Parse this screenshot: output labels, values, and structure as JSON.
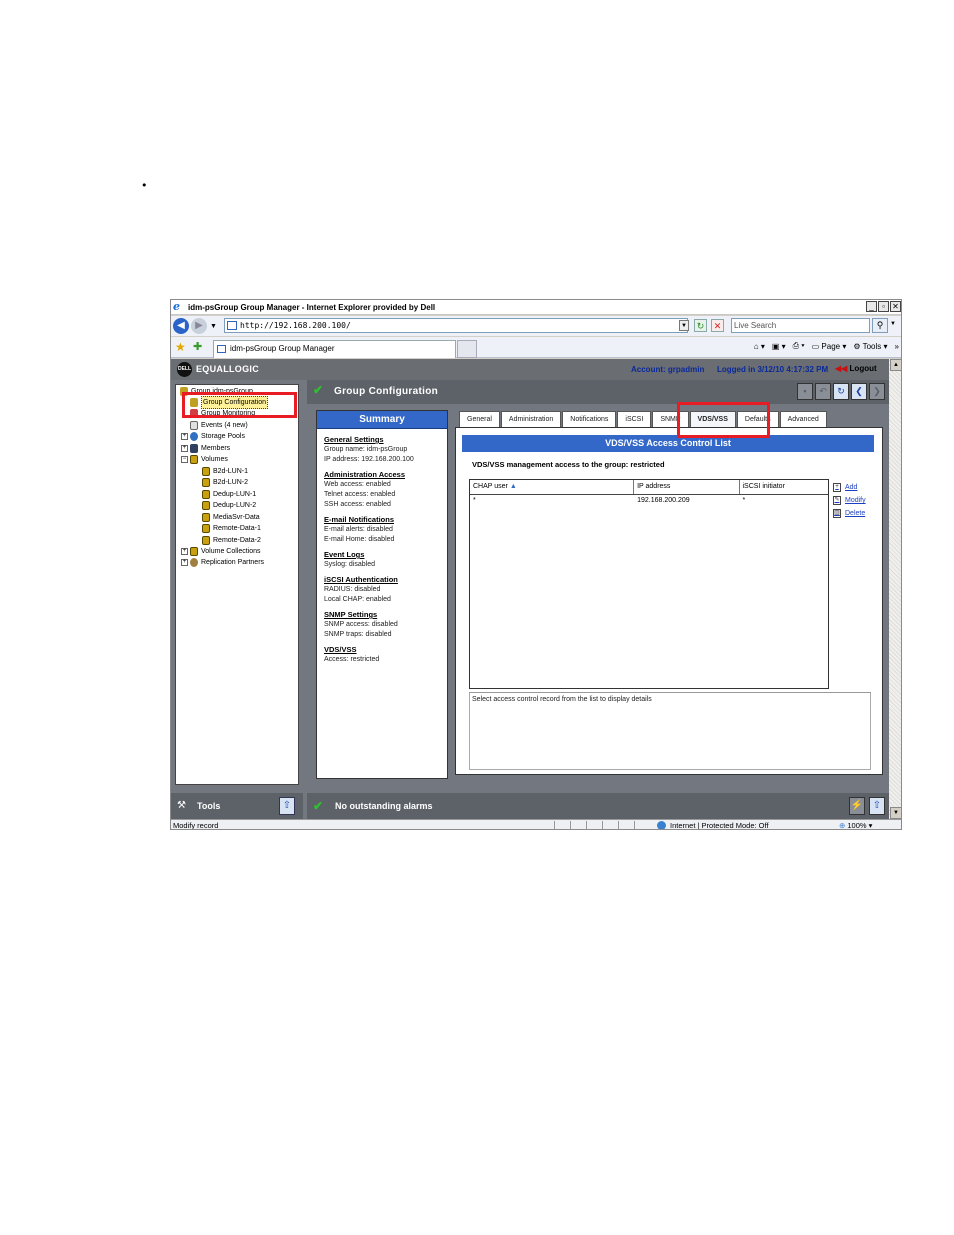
{
  "bullet": "•",
  "browser": {
    "title": "idm-psGroup Group Manager - Internet Explorer provided by Dell",
    "url": "http://192.168.200.100/",
    "search_placeholder": "Live Search",
    "tab_label": "idm-psGroup Group Manager",
    "cmd_page": "Page",
    "cmd_tools": "Tools",
    "window_buttons": [
      "_",
      "▫",
      "✕"
    ],
    "more": "»"
  },
  "app": {
    "brand": "EQUALLOGIC",
    "account": "Account: grpadmin",
    "logged_in": "Logged in 3/12/10 4:17:32 PM",
    "logout": "Logout"
  },
  "tree": {
    "items": [
      {
        "label": "Group idm-psGroup",
        "icon": "group-icon"
      },
      {
        "label": "Group Configuration",
        "icon": "group-config-icon"
      },
      {
        "label": "Group Monitoring",
        "icon": "monitoring-icon"
      },
      {
        "label": "Events (4 new)",
        "icon": "events-icon"
      },
      {
        "label": "Storage Pools",
        "icon": "storage-pool-icon"
      },
      {
        "label": "Members",
        "icon": "members-icon"
      },
      {
        "label": "Volumes",
        "icon": "volumes-icon"
      },
      {
        "label": "B2d-LUN-1",
        "icon": "volume-icon"
      },
      {
        "label": "B2d-LUN-2",
        "icon": "volume-icon"
      },
      {
        "label": "Dedup-LUN-1",
        "icon": "volume-icon"
      },
      {
        "label": "Dedup-LUN-2",
        "icon": "volume-icon"
      },
      {
        "label": "MediaSvr-Data",
        "icon": "volume-icon"
      },
      {
        "label": "Remote-Data-1",
        "icon": "volume-icon"
      },
      {
        "label": "Remote-Data-2",
        "icon": "volume-icon"
      },
      {
        "label": "Volume Collections",
        "icon": "collections-icon"
      },
      {
        "label": "Replication Partners",
        "icon": "replication-icon"
      }
    ]
  },
  "tools_label": "Tools",
  "config_header": "Group Configuration",
  "summary": {
    "title": "Summary",
    "sections": [
      {
        "heading": "General Settings",
        "lines": [
          "Group name: idm-psGroup",
          "IP address: 192.168.200.100"
        ]
      },
      {
        "heading": "Administration Access",
        "lines": [
          "Web access: enabled",
          "Telnet access: enabled",
          "SSH access: enabled"
        ]
      },
      {
        "heading": "E-mail Notifications",
        "lines": [
          "E-mail alerts: disabled",
          "E-mail Home: disabled"
        ]
      },
      {
        "heading": "Event Logs",
        "lines": [
          "Syslog: disabled"
        ]
      },
      {
        "heading": "iSCSI Authentication",
        "lines": [
          "RADIUS: disabled",
          "Local CHAP: enabled"
        ]
      },
      {
        "heading": "SNMP Settings",
        "lines": [
          "SNMP access: disabled",
          "SNMP traps: disabled"
        ]
      },
      {
        "heading": "VDS/VSS",
        "lines": [
          "Access: restricted"
        ]
      }
    ]
  },
  "tabs": [
    "General",
    "Administration",
    "Notifications",
    "iSCSI",
    "SNMP",
    "VDS/VSS",
    "Defaults",
    "Advanced"
  ],
  "vds": {
    "title": "VDS/VSS Access Control List",
    "message": "VDS/VSS management access to the group: restricted",
    "columns": [
      "CHAP user",
      "IP address",
      "iSCSI initiator"
    ],
    "rows": [
      [
        "*",
        "192.168.200.209",
        "*"
      ]
    ],
    "actions": [
      "Add",
      "Modify",
      "Delete"
    ],
    "detail_hint": "Select access control record from the list to display details"
  },
  "alarm_text": "No outstanding alarms",
  "status": {
    "left": "Modify record",
    "zone": "Internet | Protected Mode: Off",
    "zoom": "100%"
  },
  "colors": {
    "highlight_box": "#e81c24",
    "header_blue": "#3468c8",
    "bar_gray": "#5d6168",
    "ok_green": "#2cc42c"
  }
}
